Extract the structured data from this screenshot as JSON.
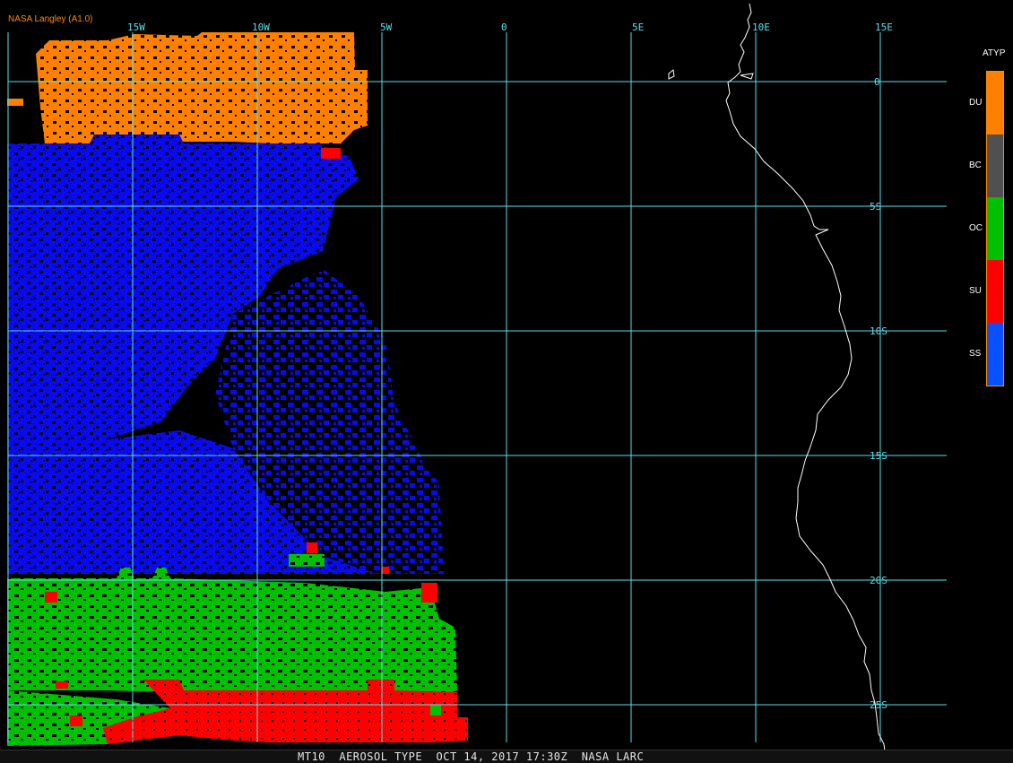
{
  "credit": "NASA Langley (A1.0)",
  "footer": "MT10  AEROSOL TYPE  OCT 14, 2017 17:30Z  NASA LARC",
  "longitude_labels": [
    "15W",
    "10W",
    "5W",
    "0",
    "5E",
    "10E",
    "15E"
  ],
  "latitude_labels": [
    "0",
    "5S",
    "10S",
    "15S",
    "20S",
    "25S"
  ],
  "legend": {
    "title": "ATYP",
    "items": [
      {
        "label": "DU",
        "color": "#ff8000"
      },
      {
        "label": "BC",
        "color": "#505050"
      },
      {
        "label": "OC",
        "color": "#00c000"
      },
      {
        "label": "SU",
        "color": "#ff0000"
      },
      {
        "label": "SS",
        "color": "#0040ff"
      }
    ]
  },
  "colors": {
    "grid": "#5ae0e8",
    "coastline": "#ffffff",
    "background": "#000000"
  }
}
